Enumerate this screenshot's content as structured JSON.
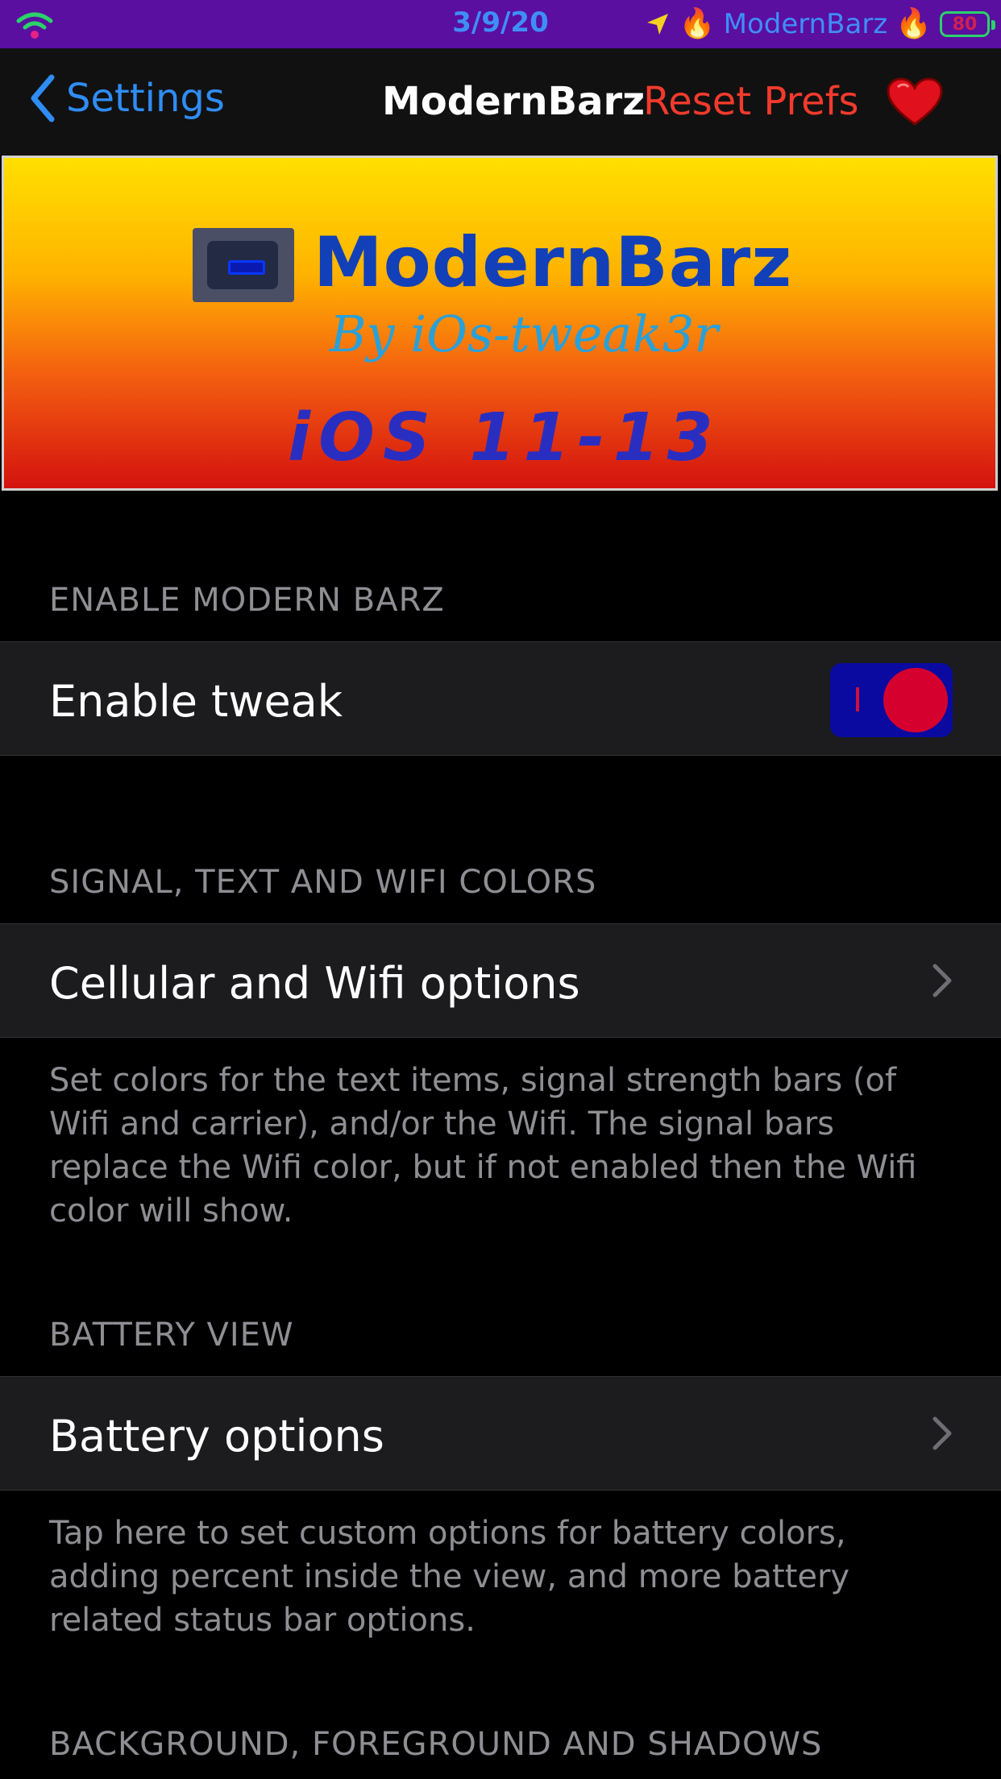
{
  "status_bar": {
    "date": "3/9/20",
    "carrier": "ModernBarz",
    "battery_percent": "80",
    "flame_glyph": "🔥",
    "background_color": "#5a0fa0",
    "text_color": "#3f8ef7",
    "icons": [
      "wifi-icon",
      "location-arrow-icon",
      "flame-icon",
      "battery-icon"
    ]
  },
  "nav": {
    "back_label": "Settings",
    "title": "ModernBarz",
    "reset_label": "Reset Prefs",
    "heart_icon": "heart-icon",
    "accent_color": "#2f8cf4",
    "reset_color": "#f23a2c"
  },
  "banner": {
    "title": "ModernBarz",
    "byline": "By iOs-tweak3r",
    "versions": "iOS 11-13",
    "icon": "battery-app-icon"
  },
  "sections": {
    "enable": {
      "header": "ENABLE MODERN BARZ",
      "toggle_label": "Enable tweak",
      "toggle_on": true
    },
    "signal": {
      "header": "SIGNAL, TEXT AND WIFI COLORS",
      "cell_label": "Cellular and Wifi options",
      "footer": "Set colors for the text items, signal strength bars (of Wifi and carrier), and/or the Wifi.  The signal bars replace the Wifi color, but if not enabled then the Wifi color will show."
    },
    "battery": {
      "header": "BATTERY VIEW",
      "cell_label": "Battery options",
      "footer": "Tap here to set custom options for battery colors, adding percent inside the view, and more battery related status bar options."
    },
    "background": {
      "header": "BACKGROUND, FOREGROUND AND SHADOWS"
    }
  }
}
